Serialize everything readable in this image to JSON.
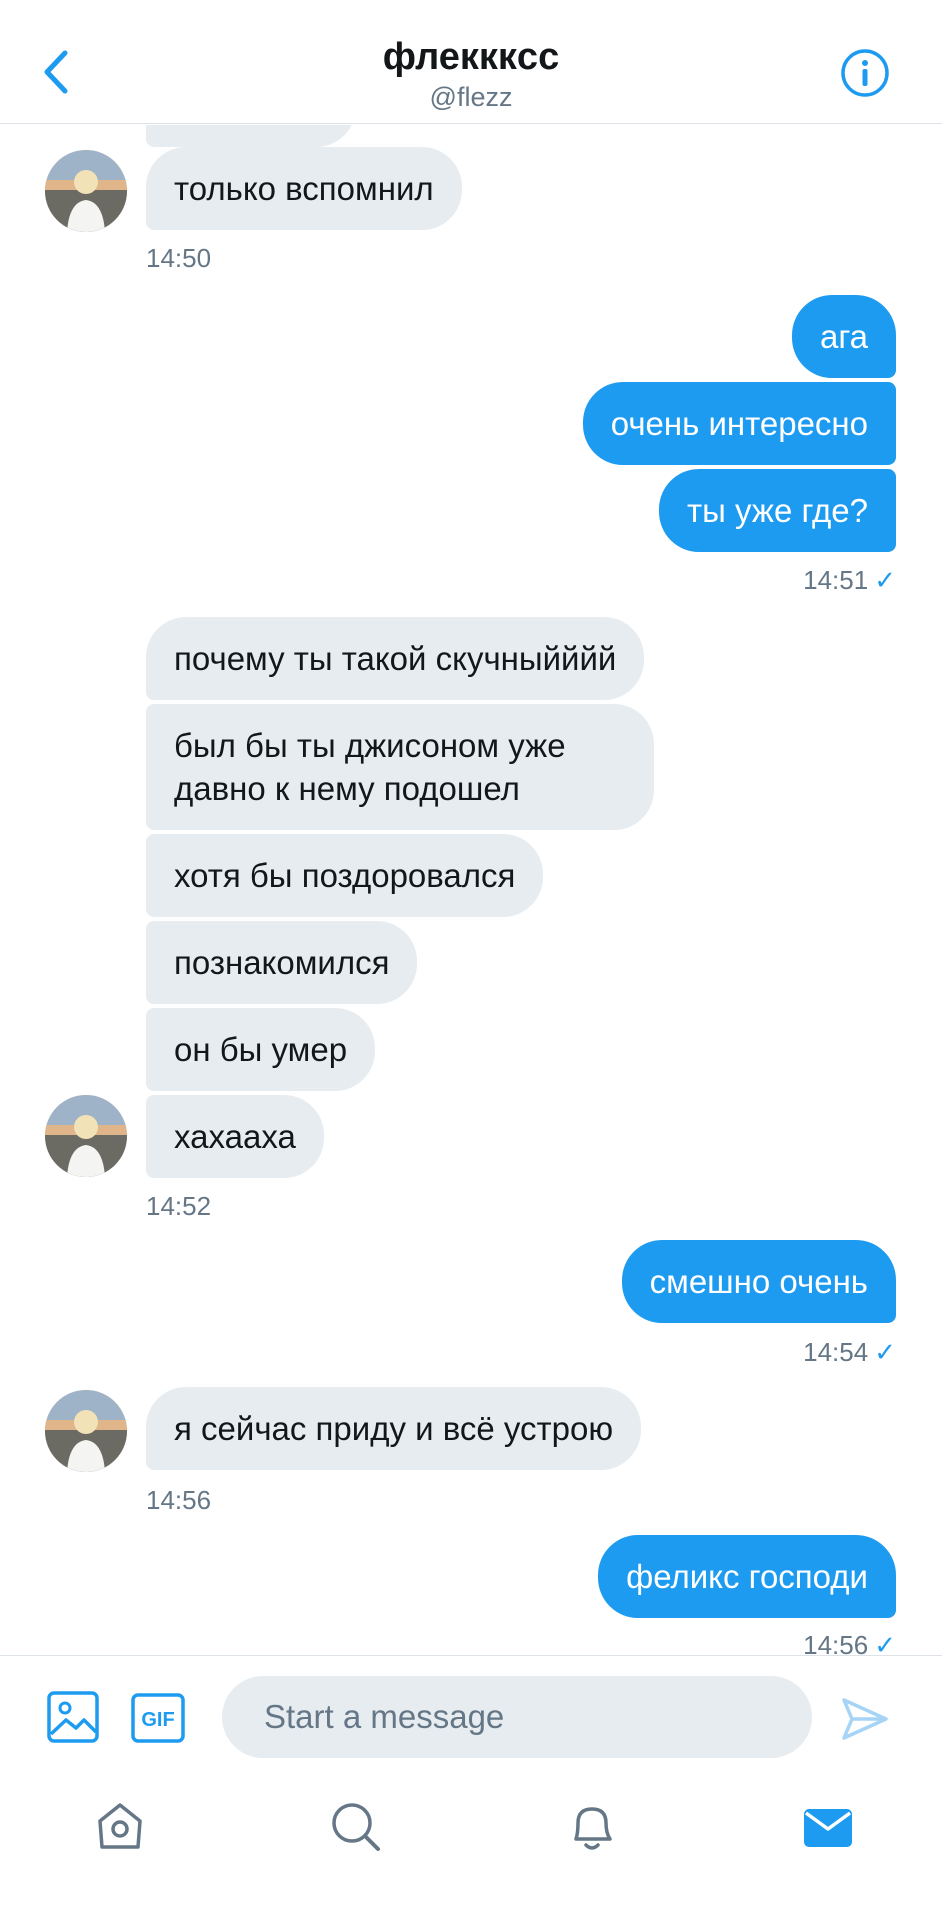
{
  "header": {
    "title": "флекккcс",
    "handle": "@flezz"
  },
  "conversation": [
    {
      "direction": "in",
      "text": "только вспомнил",
      "time": "14:50"
    },
    {
      "direction": "out",
      "text": "ага"
    },
    {
      "direction": "out",
      "text": "очень интересно"
    },
    {
      "direction": "out",
      "text": "ты уже где?",
      "time": "14:51",
      "read": true
    },
    {
      "direction": "in",
      "text": "почему ты такой скучныйййй"
    },
    {
      "direction": "in",
      "text": "был бы ты джисоном уже давно к нему подошел"
    },
    {
      "direction": "in",
      "text": "хотя бы поздоровался"
    },
    {
      "direction": "in",
      "text": "познакомился"
    },
    {
      "direction": "in",
      "text": "он бы умер"
    },
    {
      "direction": "in",
      "text": "хахааха",
      "time": "14:52"
    },
    {
      "direction": "out",
      "text": "смешно очень",
      "time": "14:54",
      "read": true
    },
    {
      "direction": "in",
      "text": "я сейчас приду и всё устрою",
      "time": "14:56"
    },
    {
      "direction": "out",
      "text": "феликс господи",
      "time": "14:56",
      "read": true
    }
  ],
  "composer": {
    "placeholder": "Start a message",
    "gif_label": "GIF"
  },
  "tabbar": {
    "items": [
      "home",
      "search",
      "notifications",
      "messages"
    ],
    "active": "messages"
  },
  "colors": {
    "accent": "#1d9bf0",
    "incoming_bubble": "#e6ecf0",
    "secondary_text": "#657786"
  }
}
